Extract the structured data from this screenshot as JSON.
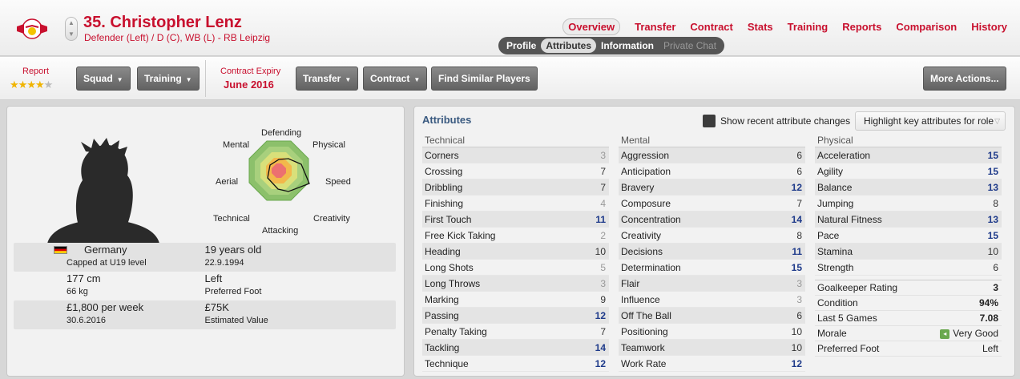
{
  "header": {
    "player_name": "35. Christopher Lenz",
    "player_sub": "Defender (Left) / D (C), WB (L) - RB Leipzig",
    "nav": [
      "Overview",
      "Transfer",
      "Contract",
      "Stats",
      "Training",
      "Reports",
      "Comparison",
      "History"
    ],
    "active_nav": "Overview",
    "subtabs": [
      "Profile",
      "Attributes",
      "Information",
      "Private Chat"
    ],
    "active_subtab": "Attributes"
  },
  "toolbar": {
    "report_label": "Report",
    "report_stars": 4,
    "squad": "Squad",
    "training": "Training",
    "contract_expiry_label": "Contract Expiry",
    "contract_expiry_value": "June 2016",
    "transfer": "Transfer",
    "contract": "Contract",
    "find_similar": "Find Similar Players",
    "more_actions": "More Actions..."
  },
  "radar": {
    "labels": {
      "defending": "Defending",
      "physical": "Physical",
      "speed": "Speed",
      "creativity": "Creativity",
      "attacking": "Attacking",
      "technical": "Technical",
      "aerial": "Aerial",
      "mental": "Mental"
    }
  },
  "profile": {
    "nationality": "Germany",
    "caps": "Capped at U19 level",
    "age": "19 years old",
    "dob": "22.9.1994",
    "height": "177 cm",
    "weight": "66 kg",
    "foot": "Left",
    "foot_label": "Preferred Foot",
    "wage": "£1,800 per week",
    "wage_date": "30.6.2016",
    "value": "£75K",
    "value_label": "Estimated Value"
  },
  "attributes": {
    "title": "Attributes",
    "show_changes": "Show recent attribute changes",
    "highlight": "Highlight key attributes for role",
    "technical_label": "Technical",
    "mental_label": "Mental",
    "physical_label": "Physical",
    "technical": [
      {
        "name": "Corners",
        "value": "3"
      },
      {
        "name": "Crossing",
        "value": "7"
      },
      {
        "name": "Dribbling",
        "value": "7"
      },
      {
        "name": "Finishing",
        "value": "4"
      },
      {
        "name": "First Touch",
        "value": "11"
      },
      {
        "name": "Free Kick Taking",
        "value": "2"
      },
      {
        "name": "Heading",
        "value": "10"
      },
      {
        "name": "Long Shots",
        "value": "5"
      },
      {
        "name": "Long Throws",
        "value": "3"
      },
      {
        "name": "Marking",
        "value": "9"
      },
      {
        "name": "Passing",
        "value": "12"
      },
      {
        "name": "Penalty Taking",
        "value": "7"
      },
      {
        "name": "Tackling",
        "value": "14"
      },
      {
        "name": "Technique",
        "value": "12"
      }
    ],
    "mental": [
      {
        "name": "Aggression",
        "value": "6"
      },
      {
        "name": "Anticipation",
        "value": "6"
      },
      {
        "name": "Bravery",
        "value": "12"
      },
      {
        "name": "Composure",
        "value": "7"
      },
      {
        "name": "Concentration",
        "value": "14"
      },
      {
        "name": "Creativity",
        "value": "8"
      },
      {
        "name": "Decisions",
        "value": "11"
      },
      {
        "name": "Determination",
        "value": "15"
      },
      {
        "name": "Flair",
        "value": "3"
      },
      {
        "name": "Influence",
        "value": "3"
      },
      {
        "name": "Off The Ball",
        "value": "6"
      },
      {
        "name": "Positioning",
        "value": "10"
      },
      {
        "name": "Teamwork",
        "value": "10"
      },
      {
        "name": "Work Rate",
        "value": "12"
      }
    ],
    "physical": [
      {
        "name": "Acceleration",
        "value": "15"
      },
      {
        "name": "Agility",
        "value": "15"
      },
      {
        "name": "Balance",
        "value": "13"
      },
      {
        "name": "Jumping",
        "value": "8"
      },
      {
        "name": "Natural Fitness",
        "value": "13"
      },
      {
        "name": "Pace",
        "value": "15"
      },
      {
        "name": "Stamina",
        "value": "10"
      },
      {
        "name": "Strength",
        "value": "6"
      }
    ],
    "summary": [
      {
        "name": "Goalkeeper Rating",
        "value": "3"
      },
      {
        "name": "Condition",
        "value": "94%"
      },
      {
        "name": "Last 5 Games",
        "value": "7.08"
      },
      {
        "name": "Morale",
        "value": "Very Good"
      },
      {
        "name": "Preferred Foot",
        "value": "Left"
      }
    ]
  },
  "colors": {
    "accent": "#c8102e",
    "attr_high": "#1e3a8a",
    "panel": "#f2f2f2"
  }
}
